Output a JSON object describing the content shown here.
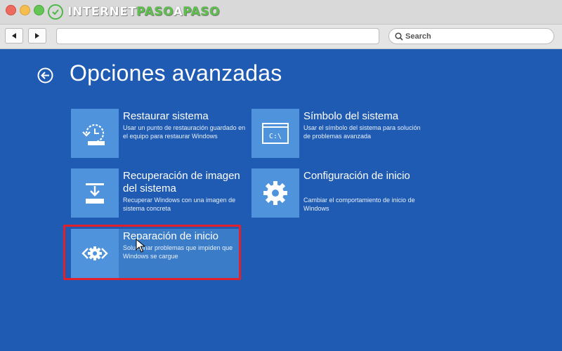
{
  "window": {
    "logo_part_a": "INTERNET",
    "logo_part_b": "PASO",
    "logo_part_c": "A",
    "logo_part_d": "PASO"
  },
  "toolbar": {
    "url_value": "",
    "search_placeholder": "Search"
  },
  "page": {
    "title": "Opciones avanzadas"
  },
  "options": [
    {
      "title": "Restaurar sistema",
      "description": "Usar un punto de restauración guardado en el equipo para restaurar Windows",
      "icon": "restore-icon"
    },
    {
      "title": "Símbolo del sistema",
      "description": "Usar el símbolo del sistema para solución de problemas avanzada",
      "icon": "command-prompt-icon",
      "icon_text": "C:\\"
    },
    {
      "title": "Recuperación de imagen del sistema",
      "description": "Recuperar Windows con una imagen de sistema concreta",
      "icon": "system-image-icon"
    },
    {
      "title": "Configuración de inicio",
      "description": "Cambiar el comportamiento de inicio de Windows",
      "icon": "gear-icon"
    },
    {
      "title": "Reparación de inicio",
      "description": "Solucionar problemas que impiden que Windows se cargue",
      "icon": "startup-repair-icon"
    }
  ],
  "colors": {
    "background": "#1f5bb3",
    "tile": "#4e93dc",
    "highlight": "#e0202a",
    "logo_green": "#5cc04b"
  }
}
